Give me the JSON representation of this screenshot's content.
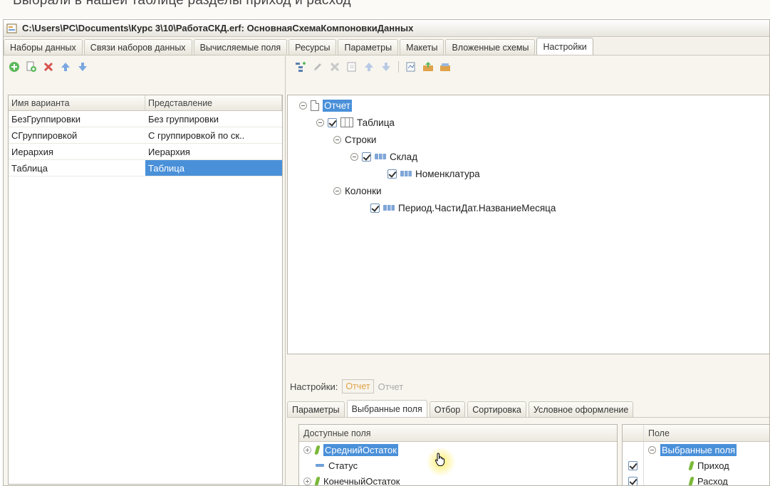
{
  "caption": "Выбрали в нашей таблице разделы приход и расход",
  "window": {
    "title": "C:\\Users\\PC\\Documents\\Курс 3\\10\\РаботаСКД.erf: ОсновнаяСхемаКомпоновкиДанных"
  },
  "tabs": [
    {
      "label": "Наборы данных",
      "active": false
    },
    {
      "label": "Связи наборов данных",
      "active": false
    },
    {
      "label": "Вычисляемые поля",
      "active": false
    },
    {
      "label": "Ресурсы",
      "active": false
    },
    {
      "label": "Параметры",
      "active": false
    },
    {
      "label": "Макеты",
      "active": false
    },
    {
      "label": "Вложенные схемы",
      "active": false
    },
    {
      "label": "Настройки",
      "active": true
    }
  ],
  "variants": {
    "columns": [
      "Имя варианта",
      "Представление"
    ],
    "rows": [
      {
        "name": "БезГруппировки",
        "presentation": "Без группировки"
      },
      {
        "name": "СГруппировкой",
        "presentation": "С группировкой по ск.."
      },
      {
        "name": "Иерархия",
        "presentation": "Иерархия"
      },
      {
        "name": "Таблица",
        "presentation": "Таблица"
      }
    ],
    "selected_index": 3
  },
  "structure": {
    "report": "Отчет",
    "table": "Таблица",
    "rows_label": "Строки",
    "warehouse": "Склад",
    "nomenclature": "Номенклатура",
    "columns_label": "Колонки",
    "period": "Период.ЧастиДат.НазваниеМесяца"
  },
  "settings": {
    "label": "Настройки:",
    "button": "Отчет",
    "value": "Отчет"
  },
  "subtabs": [
    {
      "label": "Параметры",
      "active": false
    },
    {
      "label": "Выбранные поля",
      "active": true
    },
    {
      "label": "Отбор",
      "active": false
    },
    {
      "label": "Сортировка",
      "active": false
    },
    {
      "label": "Условное оформление",
      "active": false
    }
  ],
  "available_fields": {
    "header": "Доступные поля",
    "items": [
      "СреднийОстаток",
      "Статус",
      "КонечныйОстаток"
    ]
  },
  "selected_fields": {
    "header": "Поле",
    "group": "Выбранные поля",
    "items": [
      "Приход",
      "Расход"
    ]
  }
}
